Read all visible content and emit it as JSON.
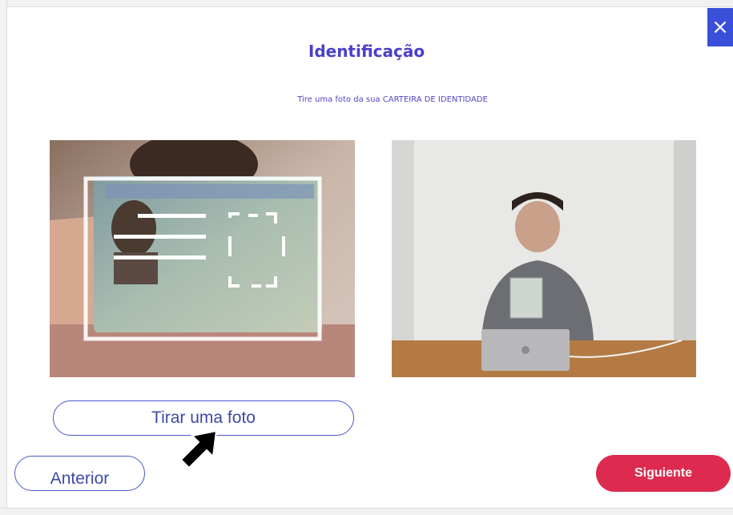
{
  "header": {
    "title": "Identificação",
    "subtitle": "Tire uma foto da sua CARTEIRA DE IDENTIDADE"
  },
  "close": {
    "icon": "close-icon",
    "label": "×"
  },
  "actions": {
    "take_photo_label": "Tirar uma foto",
    "previous_label": "Anterior",
    "next_label": "Siguiente"
  },
  "colors": {
    "accent": "#4b3fc8",
    "close_bg": "#3a4fd8",
    "next_bg": "#dc2b4e",
    "outline": "#4b56c9"
  }
}
